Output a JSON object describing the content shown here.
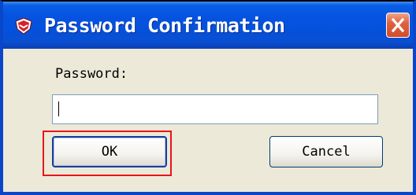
{
  "window": {
    "title": "Password Confirmation",
    "titlebar_color": "#0553e0",
    "body_color": "#ece9d8"
  },
  "app_icon": "shield-app-icon",
  "close_icon": "close-x-icon",
  "form": {
    "password_label": "Password:",
    "password_value": ""
  },
  "buttons": {
    "ok_label": "OK",
    "cancel_label": "Cancel"
  },
  "highlight_color": "#e8141b"
}
